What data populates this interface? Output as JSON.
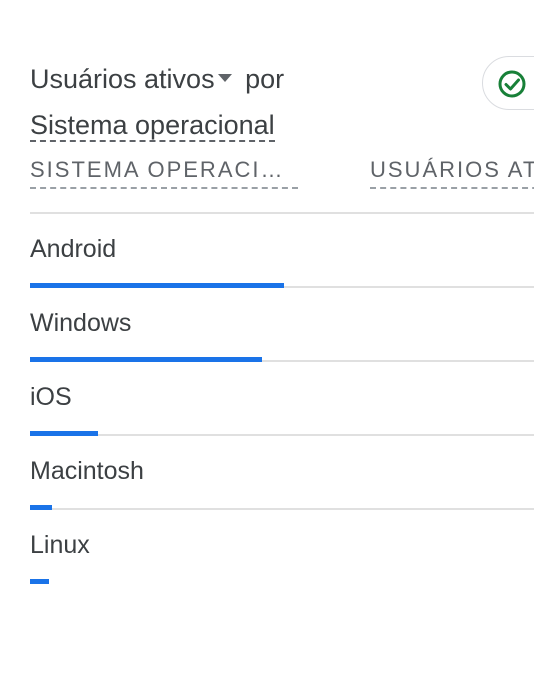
{
  "card": {
    "title": {
      "metric_label": "Usuários ativos",
      "connector": "por",
      "dimension_label": "Sistema operacional"
    },
    "status_icon": "check-circle-icon",
    "accent_color": "#1a73e8"
  },
  "table": {
    "columns": [
      {
        "label": "SISTEMA OPERACIONAL"
      },
      {
        "label": "USUÁRIOS ATIVOS"
      }
    ],
    "rows": [
      {
        "label": "Android",
        "share": 0.47
      },
      {
        "label": "Windows",
        "share": 0.43
      },
      {
        "label": "iOS",
        "share": 0.125
      },
      {
        "label": "Macintosh",
        "share": 0.04
      },
      {
        "label": "Linux",
        "share": 0.035
      }
    ]
  }
}
